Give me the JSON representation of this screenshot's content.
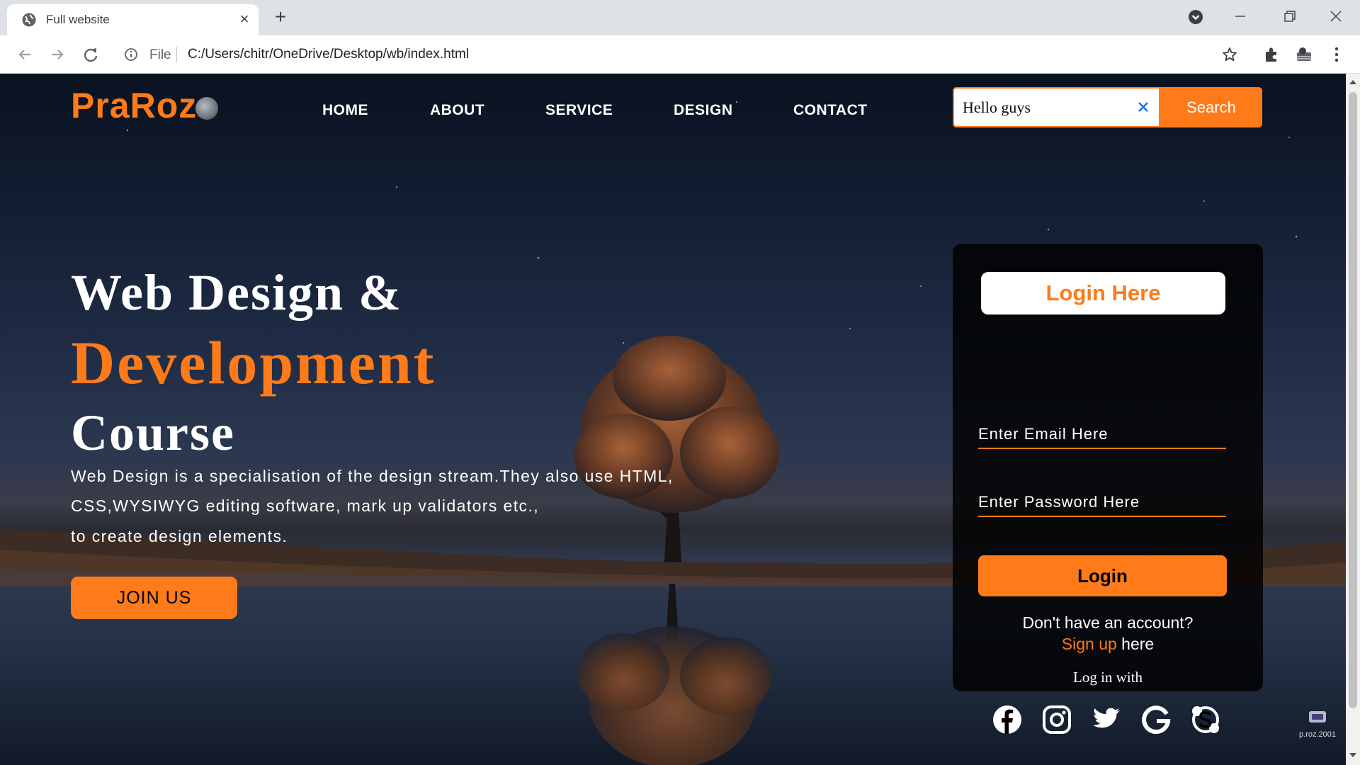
{
  "browser": {
    "tab_title": "Full website",
    "address_scheme": "File",
    "url": "C:/Users/chitr/OneDrive/Desktop/wb/index.html"
  },
  "site": {
    "logo": "PraRoz",
    "nav": [
      "HOME",
      "ABOUT",
      "SERVICE",
      "DESIGN",
      "CONTACT"
    ],
    "search_value": "Hello guys",
    "search_button": "Search"
  },
  "hero": {
    "line1": "Web Design &",
    "line2": "Development",
    "line3": "Course",
    "desc": [
      "Web Design is a specialisation of the design stream.They also use HTML,",
      "CSS,WYSIWYG editing software, mark up validators etc.,",
      "to create design elements."
    ],
    "join_button": "JOIN US"
  },
  "login": {
    "title": "Login Here",
    "email_placeholder": "Enter Email Here",
    "password_placeholder": "Enter Password Here",
    "button": "Login",
    "no_account": "Don't have an account?",
    "signup_link": "Sign up",
    "signup_suffix": " here",
    "login_with": "Log in with",
    "social_icons": [
      "facebook-icon",
      "instagram-icon",
      "twitter-icon",
      "google-icon",
      "skype-icon"
    ]
  },
  "watermark": "p.roz.2001",
  "colors": {
    "accent": "#ff7a18",
    "page_dark": "#121d31"
  }
}
